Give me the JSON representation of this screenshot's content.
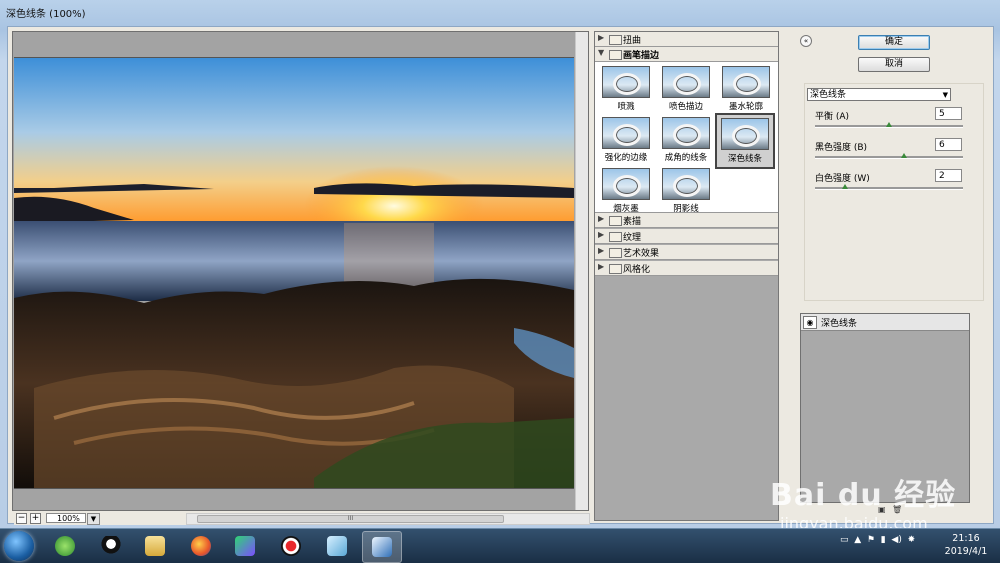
{
  "window": {
    "title": "深色线条 (100%)"
  },
  "preview": {
    "zoom": "100%",
    "zoom_out": "−",
    "zoom_in": "+",
    "scroll_grip": "III"
  },
  "tree": {
    "categories_top": [
      {
        "label": "扭曲",
        "expanded": false
      },
      {
        "label": "画笔描边",
        "expanded": true
      }
    ],
    "filters": [
      {
        "label": "喷溅",
        "selected": false
      },
      {
        "label": "喷色描边",
        "selected": false
      },
      {
        "label": "墨水轮廓",
        "selected": false
      },
      {
        "label": "强化的边缘",
        "selected": false
      },
      {
        "label": "成角的线条",
        "selected": false
      },
      {
        "label": "深色线条",
        "selected": true
      },
      {
        "label": "烟灰墨",
        "selected": false
      },
      {
        "label": "阴影线",
        "selected": false
      }
    ],
    "categories_bottom": [
      {
        "label": "素描"
      },
      {
        "label": "纹理"
      },
      {
        "label": "艺术效果"
      },
      {
        "label": "风格化"
      }
    ]
  },
  "panel": {
    "ok_label": "确定",
    "cancel_label": "取消",
    "collapse_glyph": "«",
    "filter_select": "深色线条",
    "params": [
      {
        "label": "平衡 (A)",
        "value": "5",
        "fraction": 0.5
      },
      {
        "label": "黑色强度 (B)",
        "value": "6",
        "fraction": 0.6
      },
      {
        "label": "白色强度 (W)",
        "value": "2",
        "fraction": 0.2
      }
    ],
    "layer_label": "深色线条"
  },
  "watermark": {
    "main": "Bai du 经验",
    "sub": "jingyan.baidu.com"
  },
  "taskbar": {
    "time": "21:16",
    "date": "2019/4/1"
  },
  "colors": {
    "accent": "#3c7fb1",
    "knob": "#3a8a3a"
  },
  "icons": [
    "start-orb",
    "browser-360",
    "qq",
    "explorer-folder",
    "firefox",
    "media-player",
    "record",
    "dialog-app",
    "photoshop-feather"
  ]
}
